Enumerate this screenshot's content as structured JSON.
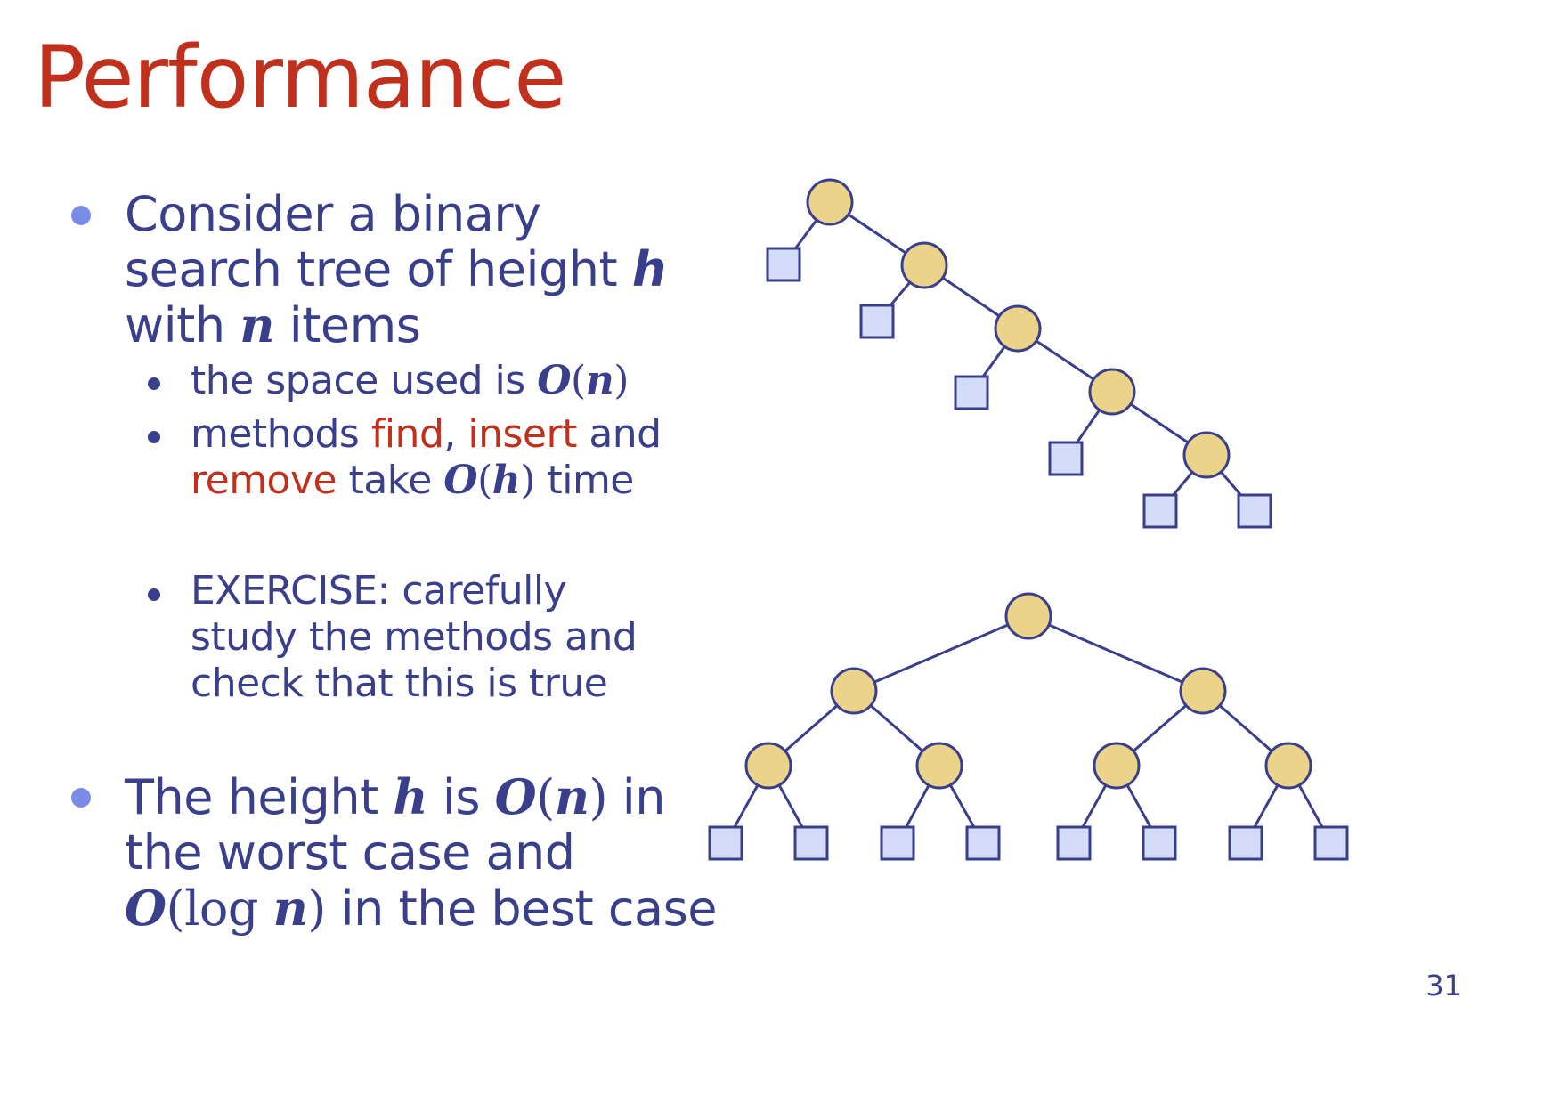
{
  "title": "Performance",
  "bullets": {
    "b1": {
      "line1": "Consider a binary",
      "line2": "search tree of height",
      "h": "h",
      "line3a": "with",
      "n": "n",
      "line3b": "items"
    },
    "s1": {
      "text": "the space used is",
      "O": "O",
      "open": "(",
      "n": "n",
      "close": ")"
    },
    "s2": {
      "w1": "methods",
      "find": "find",
      "comma": ",",
      "insert": "insert",
      "and": "and",
      "remove": "remove",
      "take": "take",
      "O": "O",
      "open": "(",
      "h": "h",
      "close": ")",
      "time": "time"
    },
    "s3": {
      "line1": "EXERCISE: carefully",
      "line2": "study the methods and",
      "line3": "check that this is true"
    },
    "b2": {
      "the_height": "The height",
      "h": "h",
      "is": "is",
      "O": "O",
      "open": "(",
      "n": "n",
      "close": ")",
      "in": "in",
      "line2": "the worst case and",
      "O2": "O",
      "open2": "(",
      "log": "log",
      "n2": "n",
      "close2": ")",
      "line3": "in the best case"
    }
  },
  "page_number": "31",
  "colors": {
    "title": "#c0301c",
    "text": "#3a3f8c",
    "bullet_level1": "#7a8ce8",
    "node_fill": "#ebd38a",
    "leaf_fill": "#d4dcf8",
    "edge": "#3a3f8c"
  },
  "diagrams": {
    "degenerate_tree": {
      "internal_nodes": 5,
      "external_nodes": 6
    },
    "balanced_tree": {
      "internal_nodes": 7,
      "external_nodes": 8
    }
  }
}
